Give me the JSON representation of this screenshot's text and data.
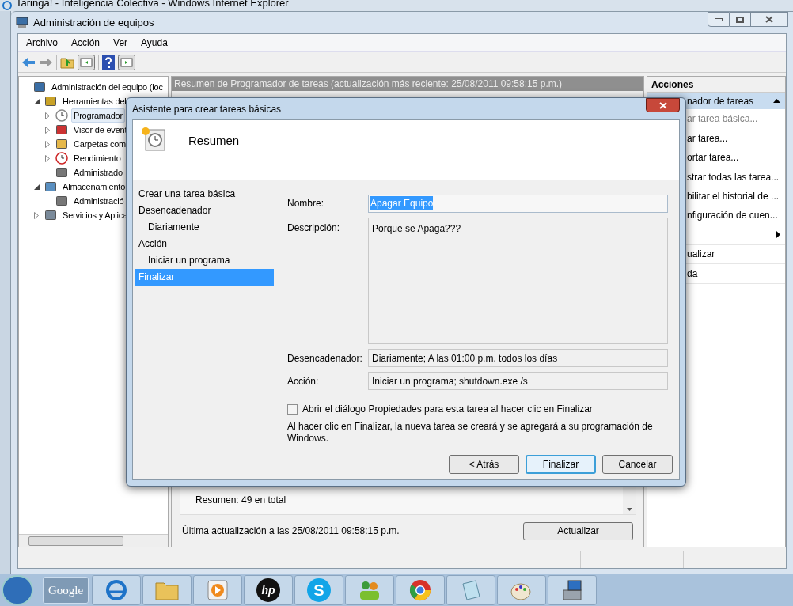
{
  "background_window": {
    "title": "Taringa! - Inteligencia Colectiva - Windows Internet Explorer"
  },
  "window": {
    "title": "Administración de equipos"
  },
  "menu": [
    "Archivo",
    "Acción",
    "Ver",
    "Ayuda"
  ],
  "tree": [
    {
      "label": "Administración del equipo (loc",
      "kind": "computer",
      "selected": false,
      "children": [
        {
          "label": "Herramientas del",
          "kind": "tools",
          "expanded": true,
          "selected": false,
          "children": [
            {
              "label": "Programador",
              "kind": "clock",
              "expanded": false,
              "selected": true
            },
            {
              "label": "Visor de event",
              "kind": "log",
              "expanded": false,
              "selected": false
            },
            {
              "label": "Carpetas com",
              "kind": "folder",
              "expanded": false,
              "selected": false
            },
            {
              "label": "Rendimiento",
              "kind": "gauge",
              "expanded": false,
              "selected": false
            },
            {
              "label": "Administrado",
              "kind": "device",
              "selected": false
            }
          ]
        },
        {
          "label": "Almacenamiento",
          "kind": "storage",
          "expanded": true,
          "selected": false,
          "children": [
            {
              "label": "Administració",
              "kind": "device",
              "selected": false
            }
          ]
        },
        {
          "label": "Servicios y Aplica",
          "kind": "server",
          "expanded": false,
          "selected": false
        }
      ]
    }
  ],
  "center": {
    "header": "Resumen de Programador de tareas (actualización más reciente: 25/08/2011 09:58:15 p.m.)",
    "summary": "Resumen: 49 en total",
    "last_update": "Última actualización a las 25/08/2011 09:58:15 p.m.",
    "refresh_button": "Actualizar"
  },
  "actions": {
    "title": "Acciones",
    "section": "nador de tareas",
    "items": [
      {
        "kind": "action",
        "label": "ar tarea básica...",
        "disabled": true
      },
      {
        "kind": "action",
        "label": "ar tarea...",
        "disabled": false
      },
      {
        "kind": "action",
        "label": "ortar tarea...",
        "disabled": false
      },
      {
        "kind": "action",
        "label": "strar todas las tarea...",
        "disabled": false
      },
      {
        "kind": "action",
        "label": "bilitar el historial de ...",
        "disabled": false
      },
      {
        "kind": "action",
        "label": "nfiguración de cuen...",
        "disabled": false
      },
      {
        "kind": "submenu"
      },
      {
        "kind": "action",
        "label": "ualizar",
        "disabled": false
      },
      {
        "kind": "action",
        "label": "da",
        "disabled": false
      }
    ]
  },
  "dialog": {
    "title": "Asistente para crear tareas básicas",
    "header": "Resumen",
    "steps": [
      {
        "label": "Crear una tarea básica",
        "selected": false
      },
      {
        "label": "Desencadenador",
        "selected": false,
        "children": [
          {
            "label": "Diariamente",
            "selected": false
          }
        ]
      },
      {
        "label": "Acción",
        "selected": false,
        "children": [
          {
            "label": "Iniciar un programa",
            "selected": false
          }
        ]
      },
      {
        "label": "Finalizar",
        "selected": true
      }
    ],
    "fields": [
      {
        "kind": "text",
        "label": "Nombre:",
        "value": "Apagar Equipo",
        "text_selected": true
      },
      {
        "kind": "multiline",
        "label": "Descripción:",
        "value": "Porque se Apaga???",
        "text_selected": false
      },
      {
        "kind": "readonly",
        "label": "Desencadenador:",
        "value": "Diariamente; A las 01:00 p.m. todos los días",
        "text_selected": false
      },
      {
        "kind": "readonly",
        "label": "Acción:",
        "value": "Iniciar un programa; shutdown.exe /s",
        "text_selected": false
      }
    ],
    "checkbox": {
      "label": "Abrir el diálogo Propiedades para esta tarea al hacer clic en Finalizar",
      "checked": false
    },
    "note": "Al hacer clic en Finalizar, la nueva tarea se creará y se agregará a su programación de Windows.",
    "buttons": [
      {
        "label": "< Atrás",
        "default": false
      },
      {
        "label": "Finalizar",
        "default": true
      },
      {
        "label": "Cancelar",
        "default": false
      }
    ]
  },
  "taskbar": {
    "gadget": "Google",
    "apps": [
      {
        "kind": "browser"
      },
      {
        "kind": "folder"
      },
      {
        "kind": "media"
      },
      {
        "kind": "logo",
        "text": "hp"
      },
      {
        "kind": "bubble",
        "text": "S"
      },
      {
        "kind": "people"
      },
      {
        "kind": "wheel"
      },
      {
        "kind": "notepad"
      },
      {
        "kind": "paint"
      },
      {
        "kind": "toolbox"
      }
    ]
  }
}
